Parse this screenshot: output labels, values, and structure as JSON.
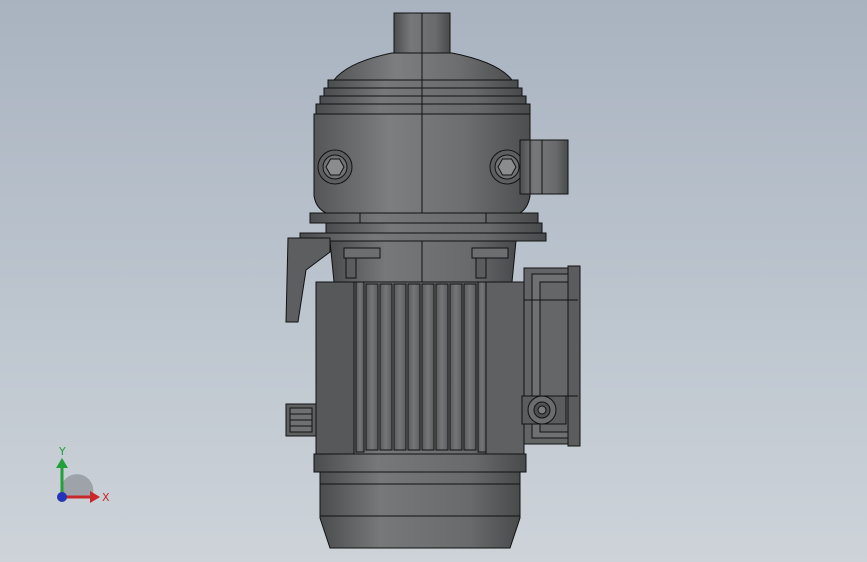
{
  "triad": {
    "x_label": "X",
    "y_label": "Y",
    "x_color": "#c8282a",
    "y_color": "#23a03a",
    "z_color": "#2433b8"
  },
  "model": {
    "body_color": "#6a6c6d",
    "highlight_color": "#8a8c8d",
    "shadow_color": "#4e5051",
    "edge_color": "#121212"
  }
}
